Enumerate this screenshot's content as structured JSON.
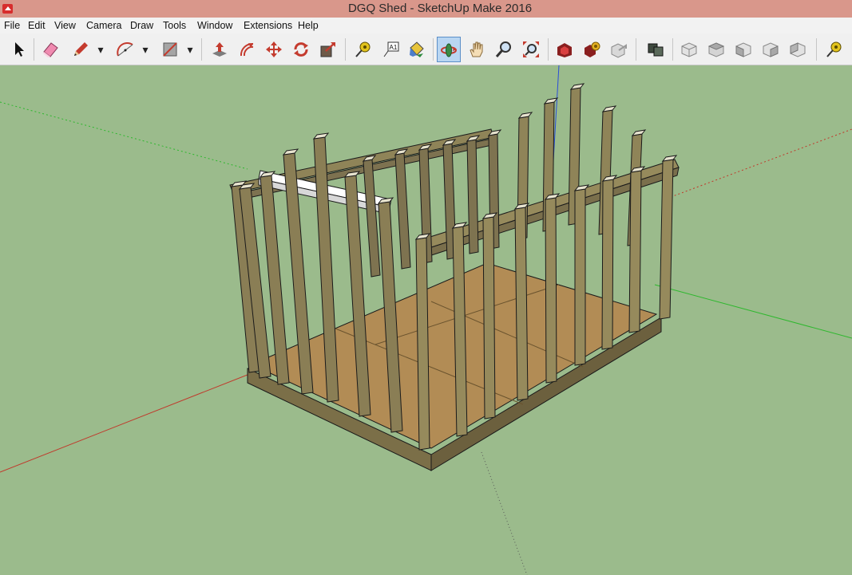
{
  "window": {
    "title": "DGQ Shed - SketchUp Make 2016"
  },
  "menu": {
    "items": [
      "File",
      "Edit",
      "View",
      "Camera",
      "Draw",
      "Tools",
      "Window",
      "Extensions",
      "Help"
    ]
  },
  "toolbar": {
    "tools": [
      {
        "id": "select",
        "icon": "arrow-cursor-icon"
      },
      {
        "id": "eraser",
        "icon": "eraser-icon"
      },
      {
        "id": "pencil",
        "icon": "pencil-icon"
      },
      {
        "id": "arc",
        "icon": "arc-icon"
      },
      {
        "id": "rectangle",
        "icon": "rectangle-icon"
      },
      {
        "id": "push-pull",
        "icon": "push-pull-icon"
      },
      {
        "id": "offset",
        "icon": "offset-icon"
      },
      {
        "id": "move",
        "icon": "move-icon"
      },
      {
        "id": "rotate",
        "icon": "rotate-icon"
      },
      {
        "id": "scale",
        "icon": "scale-icon"
      },
      {
        "id": "tape-measure",
        "icon": "tape-measure-icon"
      },
      {
        "id": "text",
        "icon": "text-label-icon"
      },
      {
        "id": "paint-bucket",
        "icon": "paint-bucket-icon"
      },
      {
        "id": "orbit",
        "icon": "orbit-icon",
        "active": true
      },
      {
        "id": "pan",
        "icon": "pan-hand-icon"
      },
      {
        "id": "zoom",
        "icon": "zoom-magnifier-icon"
      },
      {
        "id": "zoom-extents",
        "icon": "zoom-extents-icon"
      },
      {
        "id": "warehouse",
        "icon": "3d-warehouse-icon"
      },
      {
        "id": "extension-warehouse",
        "icon": "extension-warehouse-icon"
      },
      {
        "id": "share-model",
        "icon": "share-model-icon"
      },
      {
        "id": "components",
        "icon": "components-icon"
      },
      {
        "id": "view-iso",
        "icon": "iso-view-icon"
      },
      {
        "id": "view-top",
        "icon": "top-view-icon"
      },
      {
        "id": "view-front",
        "icon": "front-view-icon"
      },
      {
        "id": "view-right",
        "icon": "right-view-icon"
      },
      {
        "id": "view-back",
        "icon": "back-view-icon"
      },
      {
        "id": "tape-measure-2",
        "icon": "tape-measure-icon"
      }
    ],
    "dropdown_glyph": "▾",
    "text_tool_glyph": "A1"
  },
  "viewport": {
    "background": "#9bbb8c",
    "axis_colors": {
      "red": "#c0392b",
      "green": "#2eb82e",
      "blue": "#2a4dd8"
    },
    "wood_color": "#8a7e55",
    "floor_color": "#b28c55"
  }
}
